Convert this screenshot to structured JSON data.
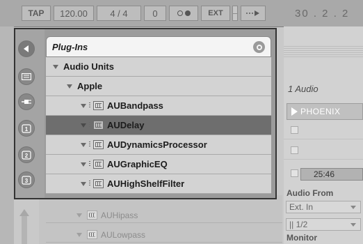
{
  "transport": {
    "tap_label": "TAP",
    "tempo": "120.00",
    "signature": "4 / 4",
    "groove": "0",
    "ext_label": "EXT",
    "arrangement_position": "30 . 2 . 2"
  },
  "browser": {
    "title": "Plug-Ins",
    "items": [
      {
        "label": "Audio Units",
        "level": 0
      },
      {
        "label": "Apple",
        "level": 1
      },
      {
        "label": "AUBandpass",
        "level": 2
      },
      {
        "label": "AUDelay",
        "level": 2,
        "selected": true
      },
      {
        "label": "AUDynamicsProcessor",
        "level": 2
      },
      {
        "label": "AUGraphicEQ",
        "level": 2
      },
      {
        "label": "AUHighShelfFilter",
        "level": 2
      }
    ],
    "hidden_items": [
      "AUHipass",
      "AULowpass"
    ]
  },
  "track": {
    "title": "1 Audio",
    "clip_name": "PHOENIX",
    "time": "25:46",
    "audio_from_label": "Audio From",
    "input_type": "Ext. In",
    "input_channel": "|| 1/2",
    "monitor_label": "Monitor"
  },
  "colors": {
    "selection": "#6e6e6e",
    "row_bg": "#d3d3d3",
    "title_bg": "#f4f4f4"
  },
  "icons": {
    "plugin": "plugin-icon",
    "search": "search-icon",
    "collapse": "triangle-expanded-icon"
  }
}
